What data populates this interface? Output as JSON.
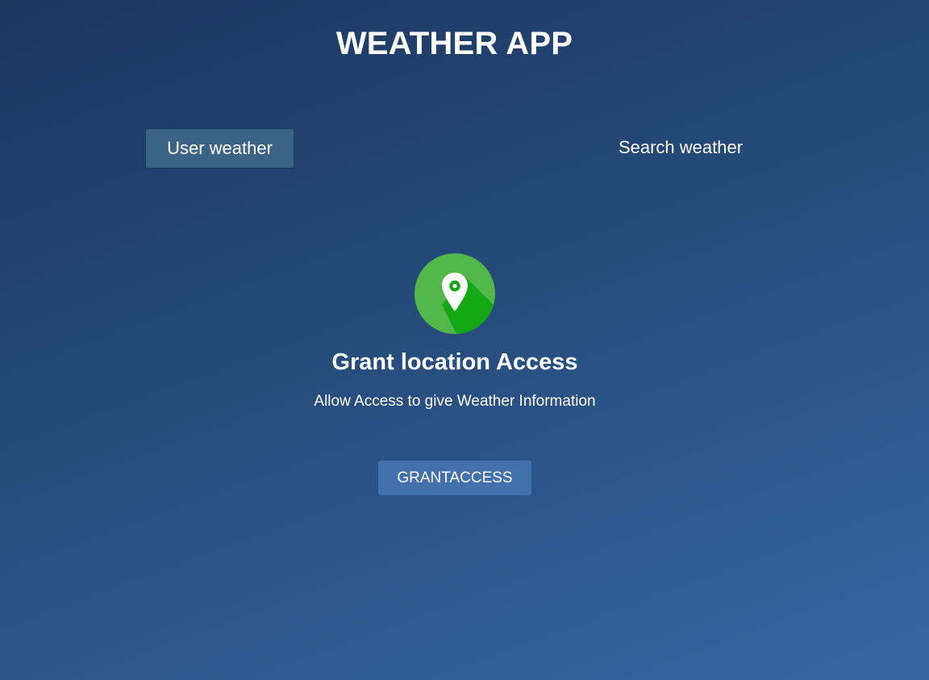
{
  "app": {
    "title": "WEATHER APP"
  },
  "tabs": {
    "user_weather": "User weather",
    "search_weather": "Search weather",
    "active": "user_weather"
  },
  "grant_access": {
    "icon": "location-pin-icon",
    "title": "Grant location Access",
    "description": "Allow Access to give Weather Information",
    "button_label": "GRANTACCESS"
  },
  "colors": {
    "background_start": "#1c3660",
    "background_end": "#3766a2",
    "active_tab": "#3a6385",
    "button": "#4271ad",
    "icon_circle": "#52b849",
    "icon_shadow": "#12a914"
  }
}
